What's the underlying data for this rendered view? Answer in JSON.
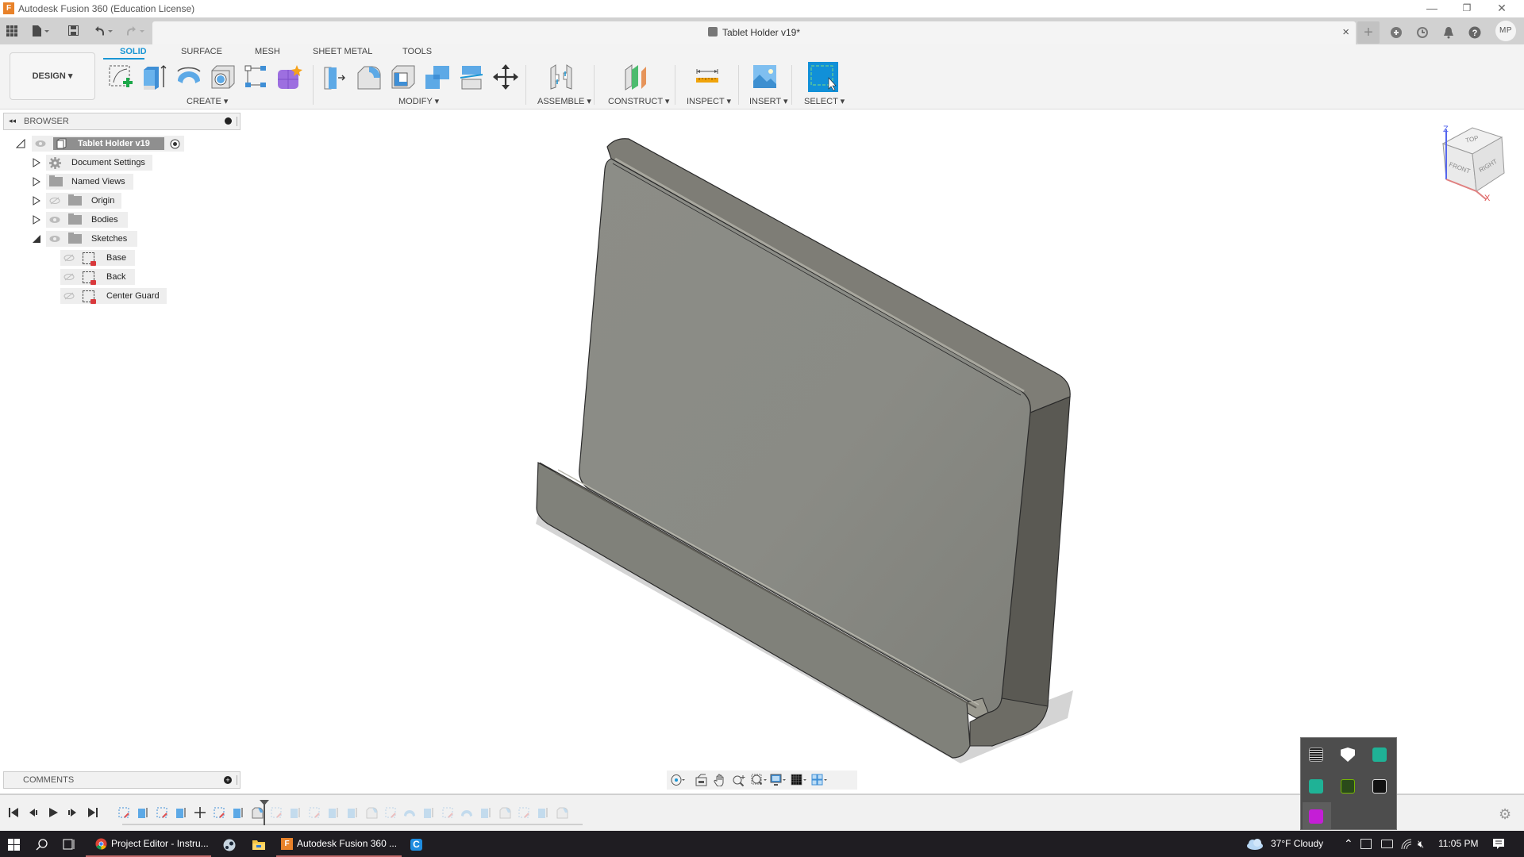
{
  "window": {
    "title": "Autodesk Fusion 360 (Education License)",
    "logo_letter": "F",
    "controls": {
      "minimize": "—",
      "restore": "❐",
      "close": "✕"
    }
  },
  "quick_access": {
    "items": [
      {
        "name": "data-panel-icon",
        "glyph": "▦"
      },
      {
        "name": "file-menu-icon",
        "glyph": "▮▾"
      },
      {
        "name": "save-icon",
        "glyph": "💾"
      },
      {
        "name": "undo-icon",
        "glyph": "↶▾"
      },
      {
        "name": "redo-icon",
        "glyph": "↷▾"
      }
    ]
  },
  "document_tab": {
    "title": "Tablet Holder v19*",
    "close": "×"
  },
  "right_bar": {
    "new_tab": "+",
    "avatar_initials": "MP"
  },
  "ribbon": {
    "workspace": "DESIGN ▾",
    "tabs": [
      {
        "label": "SOLID",
        "active": true
      },
      {
        "label": "SURFACE",
        "active": false
      },
      {
        "label": "MESH",
        "active": false
      },
      {
        "label": "SHEET METAL",
        "active": false
      },
      {
        "label": "TOOLS",
        "active": false
      }
    ],
    "groups": {
      "create": "CREATE ▾",
      "modify": "MODIFY ▾",
      "assemble": "ASSEMBLE ▾",
      "construct": "CONSTRUCT ▾",
      "inspect": "INSPECT ▾",
      "insert": "INSERT ▾",
      "select": "SELECT ▾"
    }
  },
  "browser": {
    "title": "BROWSER",
    "root": "Tablet Holder v19",
    "items": [
      {
        "label": "Document Settings",
        "icon": "gear"
      },
      {
        "label": "Named Views",
        "icon": "folder"
      },
      {
        "label": "Origin",
        "icon": "folder",
        "visible": false
      },
      {
        "label": "Bodies",
        "icon": "folder",
        "visible": true
      },
      {
        "label": "Sketches",
        "icon": "folder",
        "visible": true,
        "expanded": true
      }
    ],
    "sketches": [
      {
        "label": "Base"
      },
      {
        "label": "Back"
      },
      {
        "label": "Center Guard"
      }
    ]
  },
  "viewcube": {
    "faces": {
      "top": "TOP",
      "front": "FRONT",
      "right": "RIGHT"
    },
    "axes": {
      "z": "Z",
      "x": "X"
    }
  },
  "comments": {
    "title": "COMMENTS",
    "add": "+"
  },
  "colors": {
    "accent": "#1a96d4",
    "model_face": "#8a8b85",
    "model_dark": "#5d5c55",
    "select_blue": "#1190d8"
  },
  "taskbar": {
    "apps": [
      {
        "label": "Project Editor - Instru...",
        "open": true
      },
      {
        "label": "Autodesk Fusion 360 ...",
        "open": true
      }
    ],
    "weather": "37°F  Cloudy",
    "time": "11:05 PM"
  }
}
